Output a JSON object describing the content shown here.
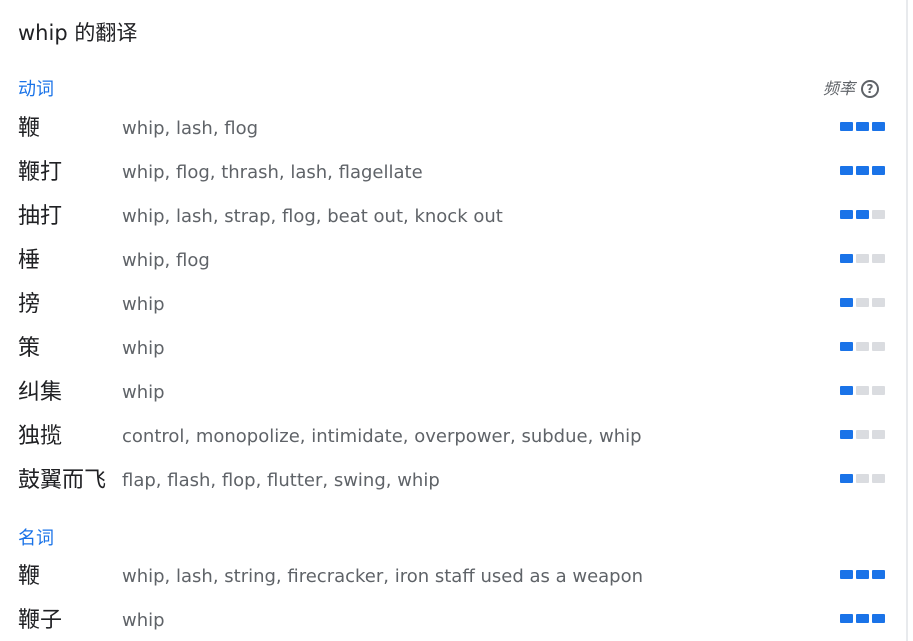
{
  "title": "whip 的翻译",
  "frequency_header": "频率",
  "colors": {
    "accent": "#1a73e8",
    "bar_off": "#dadce0"
  },
  "sections": [
    {
      "pos": "动词",
      "rows": [
        {
          "term": "鞭",
          "synonyms": "whip, lash, flog",
          "frequency": 3
        },
        {
          "term": "鞭打",
          "synonyms": "whip, flog, thrash, lash, flagellate",
          "frequency": 3
        },
        {
          "term": "抽打",
          "synonyms": "whip, lash, strap, flog, beat out, knock out",
          "frequency": 2
        },
        {
          "term": "棰",
          "synonyms": "whip, flog",
          "frequency": 1
        },
        {
          "term": "搒",
          "synonyms": "whip",
          "frequency": 1
        },
        {
          "term": "策",
          "synonyms": "whip",
          "frequency": 1
        },
        {
          "term": "纠集",
          "synonyms": "whip",
          "frequency": 1
        },
        {
          "term": "独揽",
          "synonyms": "control, monopolize, intimidate, overpower, subdue, whip",
          "frequency": 1
        },
        {
          "term": "鼓翼而飞",
          "synonyms": "flap, flash, flop, flutter, swing, whip",
          "frequency": 1
        }
      ]
    },
    {
      "pos": "名词",
      "rows": [
        {
          "term": "鞭",
          "synonyms": "whip, lash, string, firecracker, iron staff used as a weapon",
          "frequency": 3
        },
        {
          "term": "鞭子",
          "synonyms": "whip",
          "frequency": 3
        }
      ]
    }
  ]
}
